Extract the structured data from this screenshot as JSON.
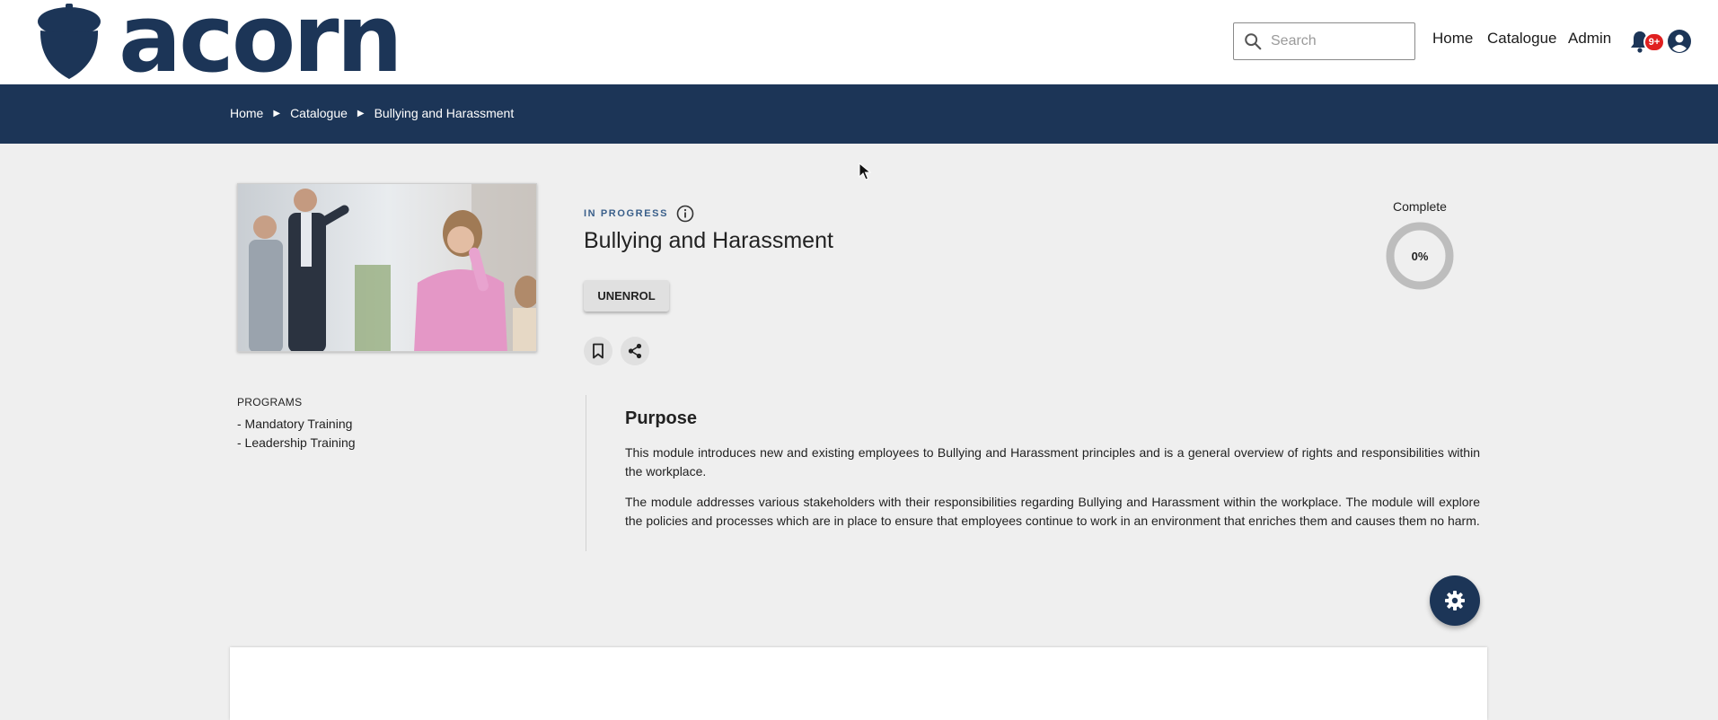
{
  "header": {
    "logo_text": "acorn",
    "search_placeholder": "Search",
    "nav": {
      "home": "Home",
      "catalogue": "Catalogue",
      "admin": "Admin"
    },
    "notifications_badge": "9+",
    "icons": [
      "acorn-logo-icon",
      "search-icon",
      "bell-icon",
      "account-icon"
    ]
  },
  "breadcrumb": [
    "Home",
    "Catalogue",
    "Bullying and Harassment"
  ],
  "module": {
    "status": "IN PROGRESS",
    "title": "Bullying and Harassment",
    "unenrol_label": "UNENROL",
    "complete_label": "Complete",
    "progress_text": "0%",
    "progress_fraction": 0
  },
  "programs": {
    "heading": "PROGRAMS",
    "items": [
      "- Mandatory Training",
      "- Leadership Training"
    ]
  },
  "purpose": {
    "heading": "Purpose",
    "paragraphs": [
      "This module introduces new and existing employees to Bullying and Harassment principles and is a general overview of rights and responsibilities within the workplace.",
      "The module addresses various stakeholders with their responsibilities regarding Bullying and Harassment within the workplace. The module will explore the policies and processes which are in place to ensure that employees continue to work in an environment that enriches them and causes them no harm."
    ]
  },
  "colors": {
    "brand_navy": "#1c3557",
    "status_blue": "#3a5f8a",
    "badge_red": "#e02020",
    "background": "#efefef"
  }
}
